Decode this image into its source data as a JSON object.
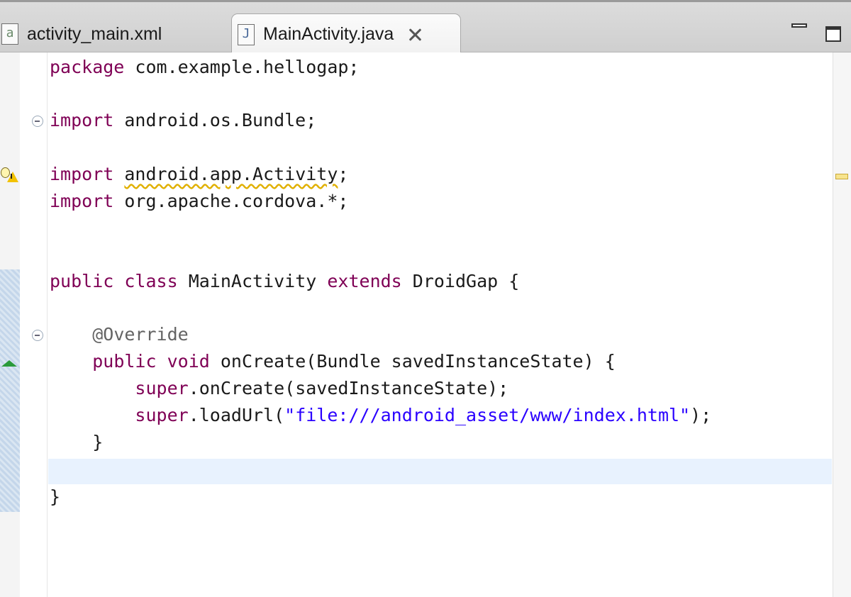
{
  "tabs": [
    {
      "label": "activity_main.xml",
      "icon": "xml-file-icon",
      "active": false
    },
    {
      "label": "MainActivity.java",
      "icon": "java-file-icon",
      "active": true
    }
  ],
  "window_controls": [
    "minimize",
    "maximize"
  ],
  "editor": {
    "current_line": 17,
    "code": {
      "l1": {
        "kw": "package",
        "rest": " com.example.hellogap;"
      },
      "l3": {
        "kw": "import",
        "rest": " android.os.Bundle;"
      },
      "l5": {
        "kw": "import",
        "warn": "android.app.Activity",
        "tail": ";"
      },
      "l6": {
        "kw": "import",
        "rest": " org.apache.cordova.*;"
      },
      "l9": {
        "kw1": "public",
        "kw2": "class",
        "mid": " MainActivity ",
        "kw3": "extends",
        "rest": " DroidGap {"
      },
      "l11": {
        "ann": "@Override"
      },
      "l12": {
        "kw1": "public",
        "kw2": "void",
        "rest": " onCreate(Bundle savedInstanceState) {"
      },
      "l13": {
        "kw": "super",
        "rest": ".onCreate(savedInstanceState);"
      },
      "l14": {
        "kw": "super",
        "mid": ".loadUrl(",
        "str": "\"file:///android_asset/www/index.html\"",
        "tail": ");"
      },
      "l15": {
        "text": "}"
      },
      "l18": {
        "text": "}"
      }
    },
    "colors": {
      "keyword": "#7f0055",
      "annotation": "#646464",
      "string": "#2a00ff",
      "current_line": "#e8f2fe",
      "warning": "#e0b000"
    }
  }
}
